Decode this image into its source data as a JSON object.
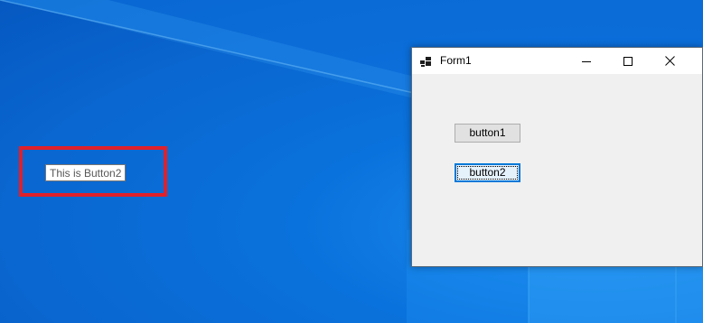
{
  "desktop": {
    "tooltip_text": "This is Button2",
    "highlight_color": "#e0202a",
    "wallpaper_color": "#0a66d0"
  },
  "window": {
    "title": "Form1",
    "icon": "form-app-icon",
    "controls": {
      "minimize_icon": "minimize-icon",
      "maximize_icon": "maximize-icon",
      "close_icon": "close-icon"
    },
    "buttons": [
      {
        "label": "button1",
        "focused": false
      },
      {
        "label": "button2",
        "focused": true
      }
    ],
    "focus_color": "#0078d7"
  }
}
